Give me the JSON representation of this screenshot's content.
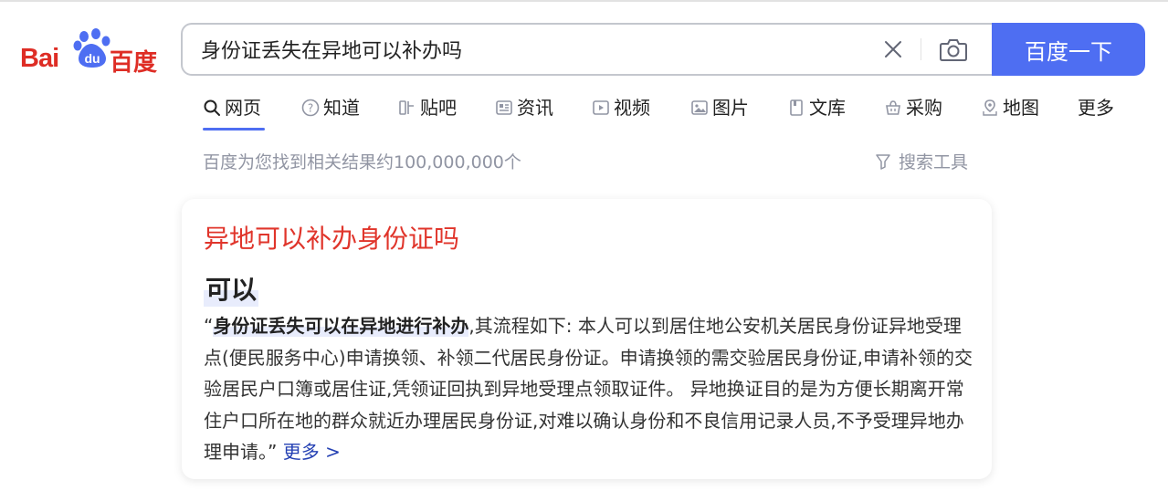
{
  "logo": {
    "latin": "Bai",
    "paw_text": "du",
    "chinese": "百度",
    "color": "#de2d25"
  },
  "search": {
    "query": "身份证丢失在异地可以补办吗",
    "button_label": "百度一下",
    "accent": "#4e6ef2"
  },
  "tabs": [
    {
      "label": "网页",
      "icon": "search-icon",
      "active": true
    },
    {
      "label": "知道",
      "icon": "question-icon"
    },
    {
      "label": "贴吧",
      "icon": "tieba-icon"
    },
    {
      "label": "资讯",
      "icon": "news-icon"
    },
    {
      "label": "视频",
      "icon": "video-icon"
    },
    {
      "label": "图片",
      "icon": "image-icon"
    },
    {
      "label": "文库",
      "icon": "document-icon"
    },
    {
      "label": "采购",
      "icon": "basket-icon"
    },
    {
      "label": "地图",
      "icon": "map-pin-icon"
    },
    {
      "label": "更多"
    }
  ],
  "results": {
    "count_text": "百度为您找到相关结果约100,000,000个",
    "tools_label": "搜索工具"
  },
  "card": {
    "title": "异地可以补办身份证吗",
    "answer": "可以",
    "quote_open": "“",
    "highlight": "身份证丢失可以在异地进行补办",
    "body": ",其流程如下: 本人可以到居住地公安机关居民身份证异地受理点(便民服务中心)申请换领、补领二代居民身份证。申请换领的需交验居民身份证,申请补领的交验居民户口簿或居住证,凭领证回执到异地受理点领取证件。 异地换证目的是为方便长期离开常住户口所在地的群众就近办理居民身份证,对难以确认身份和不良信用记录人员,不予受理异地办理申请。",
    "quote_close": "” ",
    "more_label": "更多 >",
    "title_color": "#e0352b",
    "link_color": "#2440b3"
  }
}
